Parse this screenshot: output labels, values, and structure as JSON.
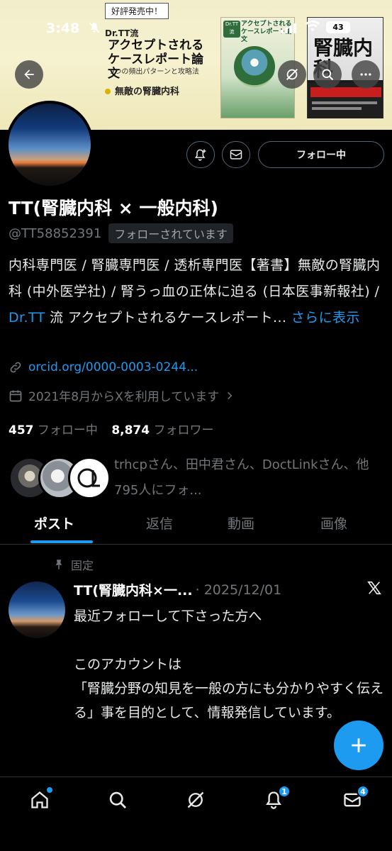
{
  "status_bar": {
    "time": "3:48",
    "battery": "43"
  },
  "banner": {
    "tag": "好評発売中！",
    "brand": "Dr.TT流",
    "title": "アクセプトされるケースレポート論文",
    "subtitle": "9つの頻出パターンと攻略法",
    "book2_label": "無敵の腎臓内科",
    "book1_title": "アクセプトされるケースレポート論文",
    "book1_badge": "Dr.TT流",
    "book2_title": "腎臓内科"
  },
  "profile": {
    "name": "TT(腎臓内科 × 一般内科)",
    "handle": "@TT58852391",
    "follows_you": "フォローされています",
    "follow_button": "フォロー中",
    "bio_text": "内科専門医 / 腎臓専門医 / 透析専門医【著書】無敵の腎臓内科 (中外医学社) / 腎うっ血の正体に迫る (日本医事新報社) / ",
    "bio_link": "Dr.TT",
    "bio_tail": " 流 アクセプトされるケースレポート...",
    "bio_more": "さらに表示",
    "website": "orcid.org/0000-0003-0244...",
    "joined": "2021年8月からXを利用しています",
    "following_count": "457",
    "following_label": "フォロー中",
    "followers_count": "8,874",
    "followers_label": "フォロワー",
    "mutuals_text": "trhcpさん、田中君さん、DoctLinkさん、他795人にフォ..."
  },
  "tabs": [
    {
      "label": "ポスト",
      "active": true
    },
    {
      "label": "返信",
      "active": false
    },
    {
      "label": "動画",
      "active": false
    },
    {
      "label": "画像",
      "active": false
    }
  ],
  "post": {
    "pinned_label": "固定",
    "author": "TT(腎臓内科×一...",
    "date": "· 2025/12/01",
    "body": "最近フォローして下さった方へ\n\nこのアカウントは\n「腎臓分野の知見を一般の方にも分かりやすく伝える」事を目的として、情報発信しています。"
  },
  "nav": {
    "notifications_badge": "1",
    "messages_badge": "4"
  },
  "colors": {
    "accent": "#1d9bf0",
    "background": "#000000",
    "muted": "#71767b"
  }
}
